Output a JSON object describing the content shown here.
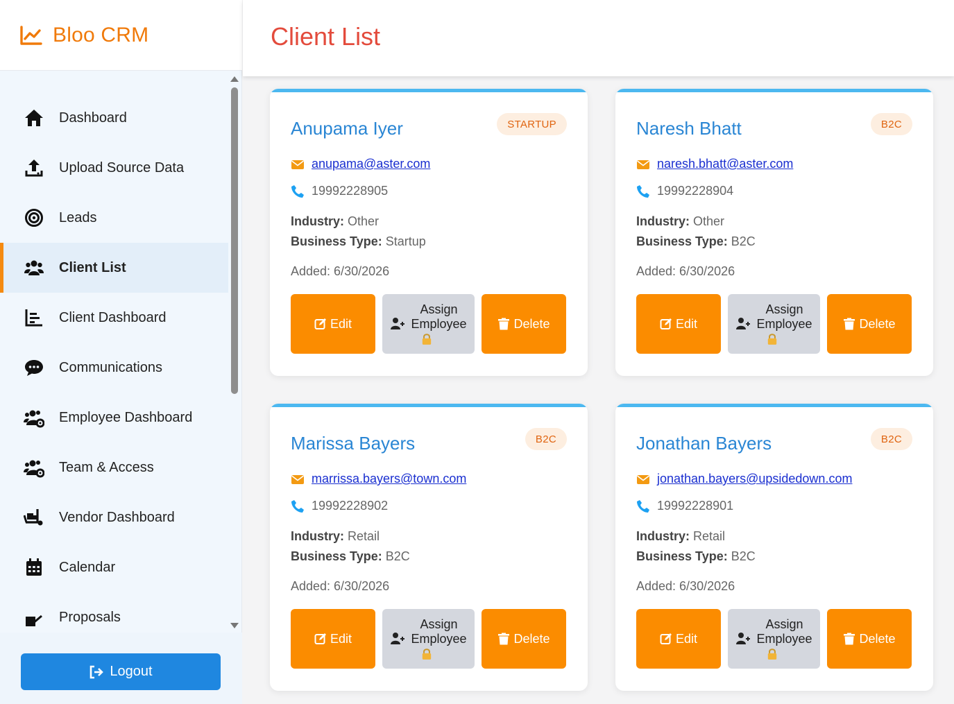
{
  "app": {
    "title": "Bloo CRM"
  },
  "sidebar": {
    "items": [
      {
        "label": "Dashboard",
        "icon": "home-icon",
        "active": false
      },
      {
        "label": "Upload Source Data",
        "icon": "upload-icon",
        "active": false
      },
      {
        "label": "Leads",
        "icon": "target-icon",
        "active": false
      },
      {
        "label": "Client List",
        "icon": "users-icon",
        "active": true
      },
      {
        "label": "Client Dashboard",
        "icon": "chart-icon",
        "active": false
      },
      {
        "label": "Communications",
        "icon": "chat-icon",
        "active": false
      },
      {
        "label": "Employee Dashboard",
        "icon": "users-cog-icon",
        "active": false
      },
      {
        "label": "Team & Access",
        "icon": "users-cog-icon",
        "active": false
      },
      {
        "label": "Vendor Dashboard",
        "icon": "dolly-icon",
        "active": false
      },
      {
        "label": "Calendar",
        "icon": "calendar-icon",
        "active": false
      },
      {
        "label": "Proposals",
        "icon": "file-signature-icon",
        "active": false
      }
    ],
    "logout_label": "Logout"
  },
  "header": {
    "title": "Client List"
  },
  "labels": {
    "industry": "Industry:",
    "business_type": "Business Type:",
    "added_prefix": "Added:",
    "edit": "Edit",
    "assign_line1": "Assign",
    "assign_line2": "Employee",
    "delete": "Delete"
  },
  "clients": [
    {
      "name": "Anupama Iyer",
      "badge": "STARTUP",
      "email": "anupama@aster.com",
      "phone": "19992228905",
      "industry": "Other",
      "business_type": "Startup",
      "added": "Added: 6/30/2026"
    },
    {
      "name": "Naresh Bhatt",
      "badge": "B2C",
      "email": "naresh.bhatt@aster.com",
      "phone": "19992228904",
      "industry": "Other",
      "business_type": "B2C",
      "added": "Added: 6/30/2026"
    },
    {
      "name": "Marissa Bayers",
      "badge": "B2C",
      "email": "marrissa.bayers@town.com",
      "phone": "19992228902",
      "industry": "Retail",
      "business_type": "B2C",
      "added": "Added: 6/30/2026"
    },
    {
      "name": "Jonathan Bayers",
      "badge": "B2C",
      "email": "jonathan.bayers@upsidedown.com",
      "phone": "19992228901",
      "industry": "Retail",
      "business_type": "B2C",
      "added": "Added: 6/30/2026"
    }
  ],
  "colors": {
    "brand": "#f07a0a",
    "title": "#e34b3c",
    "client_name": "#2a86d4",
    "action_orange": "#fb8c00",
    "logout_blue": "#1f87e0",
    "card_top_border": "#4cb8f0"
  }
}
